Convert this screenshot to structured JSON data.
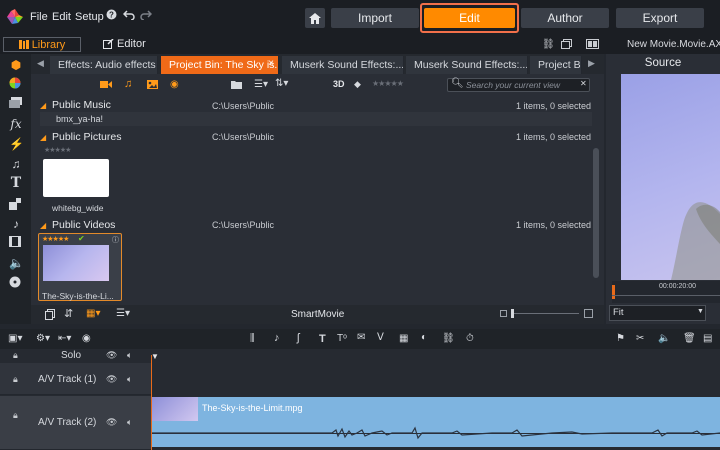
{
  "menu": {
    "file": "File",
    "edit": "Edit",
    "setup": "Setup"
  },
  "nav": {
    "import": "Import",
    "edit": "Edit",
    "author": "Author",
    "export": "Export"
  },
  "panel_tabs": {
    "library": "Library",
    "editor": "Editor"
  },
  "movie_title": "New Movie.Movie.AXP",
  "library_tabs": [
    {
      "label": "Effects: Audio effects"
    },
    {
      "label": "Project Bin: The Sky is..."
    },
    {
      "label": "Muserk Sound Effects:..."
    },
    {
      "label": "Muserk Sound Effects:..."
    },
    {
      "label": "Project B"
    }
  ],
  "toolbar": {
    "view3d": "3D",
    "search_placeholder": "Search your current view"
  },
  "sections": [
    {
      "title": "Public Music",
      "path": "C:\\Users\\Public",
      "count": "1 items, 0 selected",
      "file": "bmx_ya-ha!"
    },
    {
      "title": "Public Pictures",
      "path": "C:\\Users\\Public",
      "count": "1 items, 0 selected",
      "file": "whitebg_wide"
    },
    {
      "title": "Public Videos",
      "path": "C:\\Users\\Public",
      "count": "1 items, 0 selected",
      "file": "The-Sky-is-the-Li..."
    }
  ],
  "stars": "★★★★★",
  "smartmovie": "SmartMovie",
  "source": {
    "title": "Source",
    "timecode": "00:00:20:00",
    "fit": "Fit"
  },
  "tracks": [
    {
      "name": "Solo"
    },
    {
      "name": "A/V Track (1)"
    },
    {
      "name": "A/V Track (2)"
    }
  ],
  "clip": {
    "label": "The-Sky-is-the-Limit.mpg"
  },
  "colors": {
    "accent": "#ff8a00",
    "tab_active": "#f06a18",
    "clip": "#7eb4e0"
  }
}
